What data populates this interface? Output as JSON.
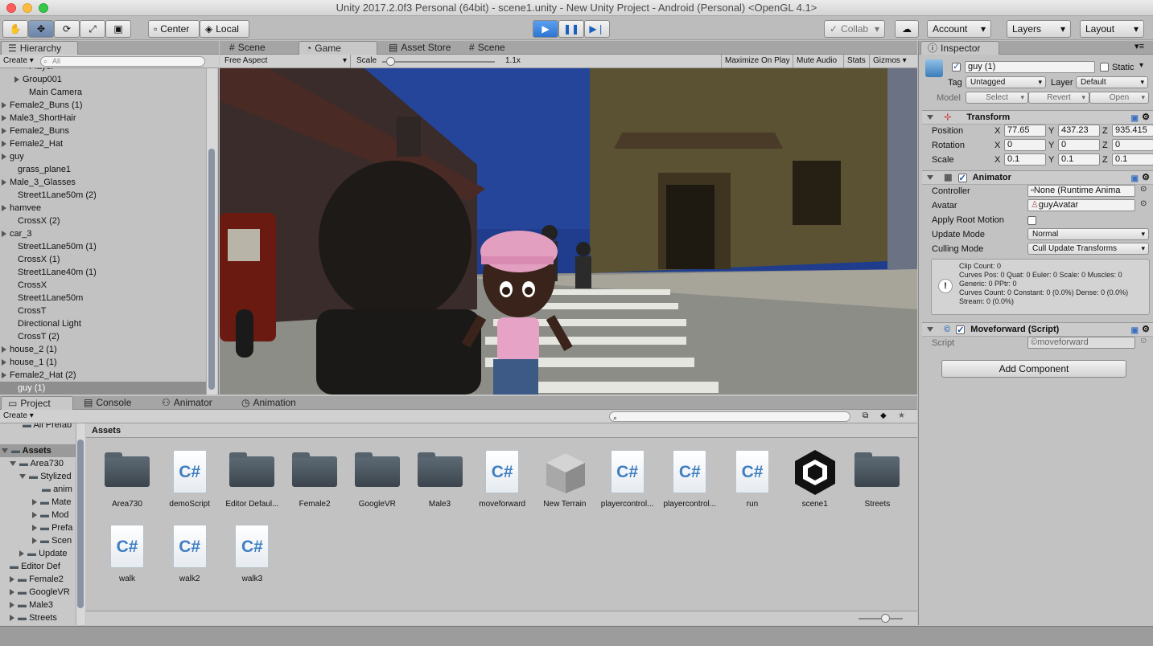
{
  "window": {
    "title": "Unity 2017.2.0f3 Personal (64bit) - scene1.unity - New Unity Project - Android (Personal) <OpenGL 4.1>"
  },
  "toolbar": {
    "center_label": "Center",
    "local_label": "Local",
    "collab_label": "Collab",
    "account_label": "Account",
    "layers_label": "Layers",
    "layout_label": "Layout"
  },
  "hierarchy": {
    "tab": "Hierarchy",
    "create": "Create",
    "search_placeholder": "All",
    "items": [
      "Player",
      "Group001",
      "Main Camera",
      "Female2_Buns (1)",
      "Male3_ShortHair",
      "Female2_Buns",
      "Female2_Hat",
      "guy",
      "grass_plane1",
      "Male_3_Glasses",
      "Street1Lane50m (2)",
      "hamvee",
      "CrossX (2)",
      "car_3",
      "Street1Lane50m (1)",
      "CrossX (1)",
      "Street1Lane40m (1)",
      "CrossX",
      "Street1Lane50m",
      "CrossT",
      "Directional Light",
      "CrossT (2)",
      "house_2 (1)",
      "house_1 (1)",
      "Female2_Hat (2)",
      "guy (1)"
    ]
  },
  "center_tabs": {
    "scene": "Scene",
    "game": "Game",
    "asset_store": "Asset Store",
    "scene2": "Scene"
  },
  "game_bar": {
    "aspect": "Free Aspect",
    "scale_label": "Scale",
    "scale_value": "1.1x",
    "maximize": "Maximize On Play",
    "mute": "Mute Audio",
    "stats": "Stats",
    "gizmos": "Gizmos"
  },
  "inspector": {
    "tab": "Inspector",
    "object_name": "guy (1)",
    "static_label": "Static",
    "tag_label": "Tag",
    "tag_value": "Untagged",
    "layer_label": "Layer",
    "layer_value": "Default",
    "model_label": "Model",
    "select": "Select",
    "revert": "Revert",
    "open": "Open",
    "transform": {
      "title": "Transform",
      "position": "Position",
      "rotation": "Rotation",
      "scale": "Scale",
      "pos": [
        "77.65",
        "437.23",
        "935.415"
      ],
      "rot": [
        "0",
        "0",
        "0"
      ],
      "scl": [
        "0.1",
        "0.1",
        "0.1"
      ]
    },
    "animator": {
      "title": "Animator",
      "controller_label": "Controller",
      "controller_value": "None (Runtime Anima",
      "avatar_label": "Avatar",
      "avatar_value": "guyAvatar",
      "apply_root_label": "Apply Root Motion",
      "update_label": "Update Mode",
      "update_value": "Normal",
      "culling_label": "Culling Mode",
      "culling_value": "Cull Update Transforms",
      "info": [
        "Clip Count: 0",
        "Curves Pos: 0 Quat: 0 Euler: 0 Scale: 0 Muscles: 0",
        "Generic: 0 PPtr: 0",
        "Curves Count: 0 Constant: 0 (0.0%) Dense: 0 (0.0%)",
        "Stream: 0 (0.0%)"
      ]
    },
    "moveforward": {
      "title": "Moveforward (Script)",
      "script_label": "Script",
      "script_value": "moveforward"
    },
    "add_component": "Add Component"
  },
  "bottom_tabs": {
    "project": "Project",
    "console": "Console",
    "animator": "Animator",
    "animation": "Animation",
    "create": "Create"
  },
  "project_tree": [
    "All Prefab",
    "Assets",
    "Area730",
    "Stylized",
    "anim",
    "Mate",
    "Mod",
    "Prefa",
    "Scen",
    "Update",
    "Editor Def",
    "Female2",
    "GoogleVR",
    "Male3",
    "Streets"
  ],
  "assets_header": "Assets",
  "assets": [
    {
      "name": "Area730",
      "type": "folder"
    },
    {
      "name": "demoScript",
      "type": "cs"
    },
    {
      "name": "Editor Defaul...",
      "type": "folder"
    },
    {
      "name": "Female2",
      "type": "folder"
    },
    {
      "name": "GoogleVR",
      "type": "folder"
    },
    {
      "name": "Male3",
      "type": "folder"
    },
    {
      "name": "moveforward",
      "type": "cs"
    },
    {
      "name": "New Terrain",
      "type": "terrain"
    },
    {
      "name": "playercontrol...",
      "type": "cs"
    },
    {
      "name": "playercontrol...",
      "type": "cs"
    },
    {
      "name": "run",
      "type": "cs"
    },
    {
      "name": "scene1",
      "type": "unity"
    },
    {
      "name": "Streets",
      "type": "folder"
    },
    {
      "name": "walk",
      "type": "cs"
    },
    {
      "name": "walk2",
      "type": "cs"
    },
    {
      "name": "walk3",
      "type": "cs"
    }
  ]
}
